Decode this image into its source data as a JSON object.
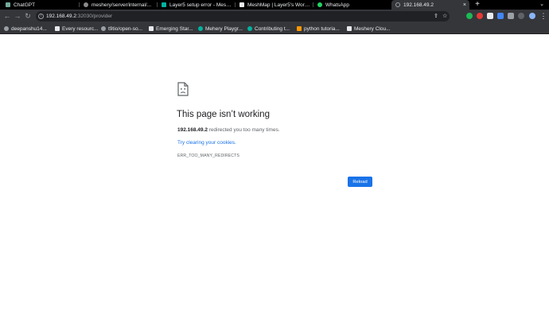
{
  "tabs": [
    {
      "title": "ChatGPT",
      "favicon_color": "#74aa9c"
    },
    {
      "title": "meshery/server/internal/...",
      "favicon_color": "#8b8b8b"
    },
    {
      "title": "Layer5 setup error - Mesh...",
      "favicon_color": "#00b39f"
    },
    {
      "title": "MeshMap | Layer5's Work...",
      "favicon_color": "#e8eaed"
    },
    {
      "title": "WhatsApp",
      "favicon_color": "#25d366"
    },
    {
      "title": "192.168.49.2",
      "favicon_color": "#9aa0a6",
      "active": true
    }
  ],
  "toolbar": {
    "url_host": "192.168.49.2",
    "url_path": ":32030/provider"
  },
  "bookmarks": [
    {
      "label": "deepanshu14...",
      "color": "#9aa0a6"
    },
    {
      "label": "Every resourc...",
      "color": "#e8eaed"
    },
    {
      "label": "t9tio/open-so...",
      "color": "#9aa0a6"
    },
    {
      "label": "Emerging Star...",
      "color": "#e8eaed"
    },
    {
      "label": "Mehery Playgr...",
      "color": "#00b39f"
    },
    {
      "label": "Contributing t...",
      "color": "#00b39f"
    },
    {
      "label": "python tutoria...",
      "color": "#ff9800"
    },
    {
      "label": "Meshery Clou...",
      "color": "#e8eaed"
    }
  ],
  "error": {
    "title": "This page isn’t working",
    "host": "192.168.49.2",
    "description": " redirected you too many times.",
    "link": "Try clearing your cookies.",
    "code": "ERR_TOO_MANY_REDIRECTS",
    "reload_label": "Reload"
  },
  "colors": {
    "accent": "#1a73e8",
    "tabbar_bg": "#000000",
    "toolbar_bg": "#35363a"
  }
}
